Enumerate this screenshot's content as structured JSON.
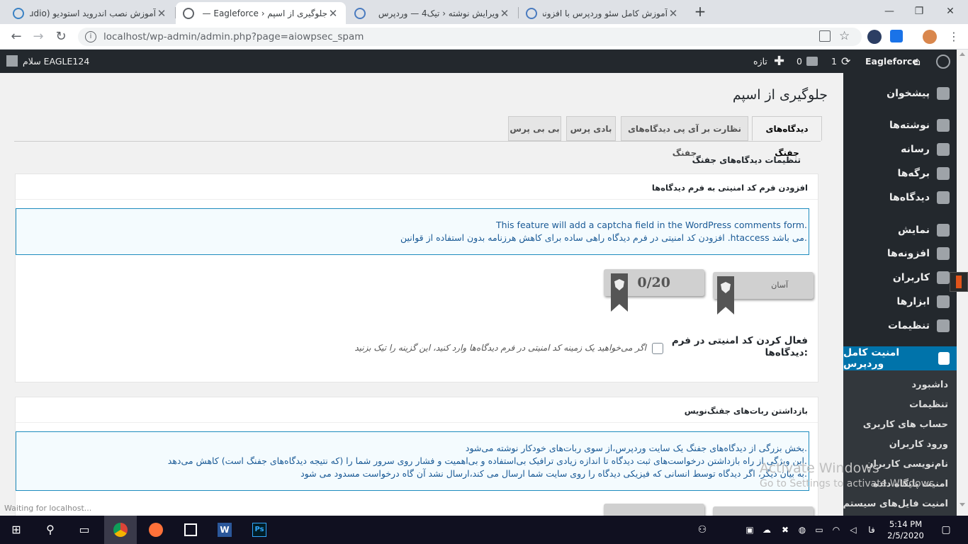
{
  "browser": {
    "tabs": [
      {
        "title": "آموزش نصب اندروید استودیو (Android Studio)"
      },
      {
        "title": "جلوگیری از اسپم ‹ Eagleforce — وردپرس"
      },
      {
        "title": "ویرایش نوشته ‹ تیک4 — وردپرس"
      },
      {
        "title": "آموزش کامل سئو وردپرس با افزونه"
      }
    ],
    "new_tab": "+",
    "url": "localhost/wp-admin/admin.php?page=aiowpsec_spam",
    "status": "Waiting for localhost..."
  },
  "adminbar": {
    "greeting": "سلام EAGLE124",
    "site_name": "Eagleforce",
    "updates_count": "1",
    "comments_count": "0",
    "new_label": "تازه"
  },
  "sidebar": {
    "items": [
      {
        "label": "پیشخوان"
      },
      {
        "label": "نوشته‌ها"
      },
      {
        "label": "رسانه"
      },
      {
        "label": "برگه‌ها"
      },
      {
        "label": "دیدگاه‌ها"
      },
      {
        "label": "نمایش"
      },
      {
        "label": "افزونه‌ها"
      },
      {
        "label": "کاربران"
      },
      {
        "label": "ابزارها"
      },
      {
        "label": "تنظیمات"
      },
      {
        "label": "امنیت کامل وردپرس"
      }
    ],
    "submenu": [
      {
        "label": "داشبورد"
      },
      {
        "label": "تنظیمات"
      },
      {
        "label": "حساب های کاربری"
      },
      {
        "label": "ورود کاربران"
      },
      {
        "label": "نام‌نویسی کاربران"
      },
      {
        "label": "امنیت پایگاه داده"
      },
      {
        "label": "امنیت فایل‌های سیستم"
      }
    ]
  },
  "page": {
    "title": "جلوگیری از اسپم",
    "tabs": [
      {
        "label": "دیدگاه‌های جفنگ"
      },
      {
        "label": "نظارت بر آی پی دیدگاه‌های جفنگ"
      },
      {
        "label": "بادی پرس"
      },
      {
        "label": "بی بی پرس"
      }
    ],
    "settings_heading": "تنظیمات دیدگاه‌های جفنگ",
    "box1": {
      "title": "افزودن فرم کد امنیتی به فرم دیدگاه‌ها",
      "info_line1": "This feature will add a captcha field in the WordPress comments form.",
      "info_line2": "افزودن کد امنیتی در فرم دیدگاه راهی ساده برای کاهش هرزنامه بدون استفاده از قوانین .htaccess می باشد.",
      "difficulty": "آسان",
      "points": "0/20",
      "option_label": "فعال کردن کد امنیتی در فرم دیدگاه‌ها:",
      "option_desc": "اگر می‌خواهید یک زمینه کد امنیتی در فرم دیدگاه‌ها وارد کنید، این گزینه را تیک بزنید",
      "checked": false
    },
    "box2": {
      "title": "بازداشتن ربات‌های جفنگ‌نویس",
      "info_line1": "بخش بزرگی از دیدگاه‌های جفنگ یک سایت وردپرس،از سوی ربات‌های خودکار نوشته می‌شود.",
      "info_line2": "این ویژگی از راه بازداشتن درخواست‌های ثبت دیدگاه تا اندازه زیادی ترافیک بی‌استفاده و بی‌اهمیت و فشار روی سرور شما را (که نتیجه دیدگاه‌های جفنگ است) کاهش می‌دهد.",
      "info_line3": "به بیان دیگر، اگر دیدگاه توسط انسانی که فیزیکی دیدگاه را روی سایت شما ارسال می کند،ارسال نشد آن گاه درخواست مسدود می شود."
    }
  },
  "watermark": {
    "line1": "Activate Windows",
    "line2": "Go to Settings to activate Windows."
  },
  "taskbar": {
    "time": "5:14 PM",
    "date": "2/5/2020",
    "lang": "فا"
  },
  "icons": [
    "windows-logo-icon",
    "search-icon",
    "task-view-icon",
    "chrome-icon",
    "firefox-icon",
    "word-icon",
    "photoshop-icon"
  ]
}
